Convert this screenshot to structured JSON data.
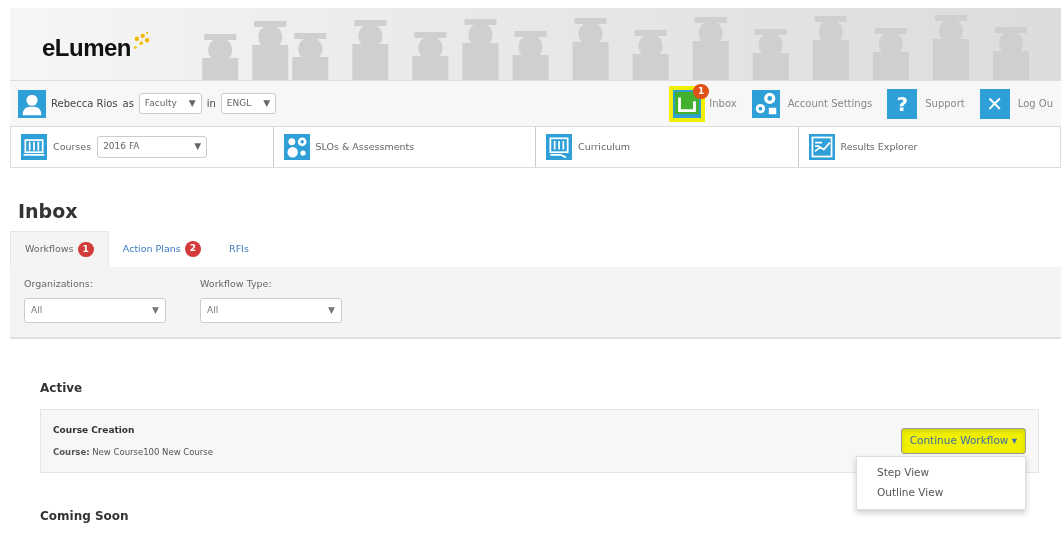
{
  "header": {
    "logo": "eLumen"
  },
  "caret": "▼",
  "user_bar": {
    "user": "Rebecca Rios",
    "as_label": "as",
    "role": "Faculty",
    "in_label": "in",
    "department": "ENGL",
    "links": [
      {
        "kind": "inbox",
        "label": "Inbox",
        "badge": "1",
        "highlighted": true
      },
      {
        "kind": "settings",
        "label": "Account Settings",
        "highlighted": false
      },
      {
        "kind": "char",
        "icon_char": "?",
        "label": "Support",
        "highlighted": false
      },
      {
        "kind": "char",
        "icon_char": "✕",
        "label": "Log Ou",
        "highlighted": false
      }
    ]
  },
  "nav": [
    {
      "kind": "courses",
      "label": "Courses",
      "select": "2016 FA"
    },
    {
      "kind": "slos",
      "label": "SLOs & Assessments"
    },
    {
      "kind": "curriculum",
      "label": "Curriculum"
    },
    {
      "kind": "results",
      "label": "Results Explorer"
    }
  ],
  "page_title": "Inbox",
  "tabs": [
    {
      "label": "Workflows",
      "badge": "1",
      "selected": true
    },
    {
      "label": "Action Plans",
      "badge": "2",
      "selected": false
    },
    {
      "label": "RFIs",
      "selected": false
    }
  ],
  "filters": [
    {
      "label": "Organizations:",
      "value": "All"
    },
    {
      "label": "Workflow Type:",
      "value": "All"
    }
  ],
  "sections": [
    {
      "title": "Active",
      "items": [
        {
          "title": "Course Creation",
          "field_label": "Course:",
          "field_value": "New Course100 New Course",
          "button": {
            "label": "Continue Workflow ▾",
            "highlighted": true,
            "expanded": true,
            "menu": [
              "Step View",
              "Outline View"
            ]
          }
        }
      ]
    },
    {
      "title": "Coming Soon"
    }
  ]
}
